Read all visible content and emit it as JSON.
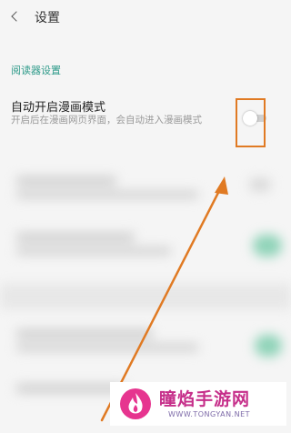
{
  "header": {
    "title": "设置"
  },
  "section": {
    "title": "阅读器设置"
  },
  "setting": {
    "title": "自动开启漫画模式",
    "description": "开启后在漫画网页界面，会自动进入漫画模式",
    "enabled": false
  },
  "annotation": {
    "color": "#e07a23"
  },
  "watermark": {
    "title": "瞳焰手游网",
    "site": "WWW.TONGYAN.NET"
  },
  "colors": {
    "accent": "#2f9b8a",
    "brand": "#c62f8a"
  }
}
